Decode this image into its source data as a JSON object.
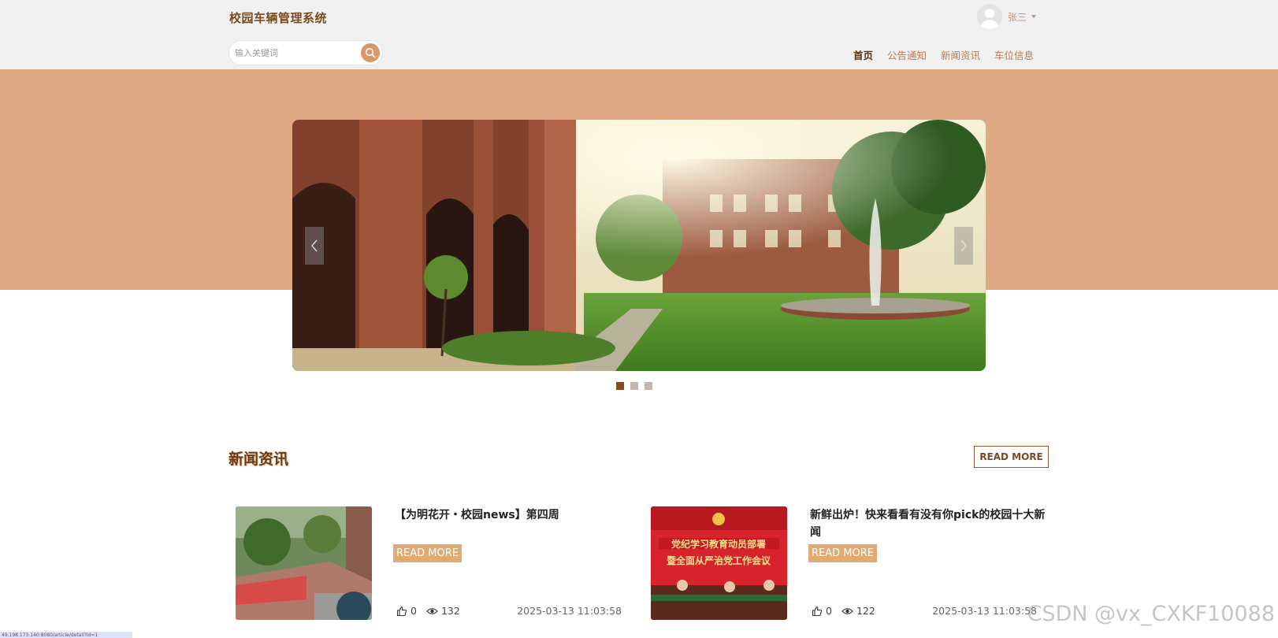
{
  "header": {
    "brand": "校园车辆管理系统",
    "user_name": "张三",
    "search_placeholder": "输入关键词",
    "nav": [
      {
        "label": "首页",
        "active": true
      },
      {
        "label": "公告通知",
        "active": false
      },
      {
        "label": "新闻资讯",
        "active": false
      },
      {
        "label": "车位信息",
        "active": false
      }
    ]
  },
  "colors": {
    "accent": "#dfa986",
    "brand": "#7a4a1e",
    "button": "#e0aa72"
  },
  "carousel": {
    "slide_count": 3,
    "active_index": 0,
    "image": "campus-courtyard-fountain"
  },
  "news": {
    "section_title": "新闻资讯",
    "read_more_label": "READ MORE",
    "items": [
      {
        "title": "【为明花开・校园news】第四周",
        "button": "READ MORE",
        "likes": "0",
        "views": "132",
        "date": "2025-03-13 11:03:58",
        "image": "campus-garden-photo"
      },
      {
        "title": "新鲜出炉！快来看看有没有你pick的校园十大新闻",
        "button": "READ MORE",
        "likes": "0",
        "views": "122",
        "date": "2025-03-13 11:03:58",
        "image": "meeting-stage-photo"
      }
    ]
  },
  "overlay": {
    "status_url": "49.198.173.140:8080/article/detail?id=1",
    "watermark": "CSDN @vx_CXKF10088"
  }
}
